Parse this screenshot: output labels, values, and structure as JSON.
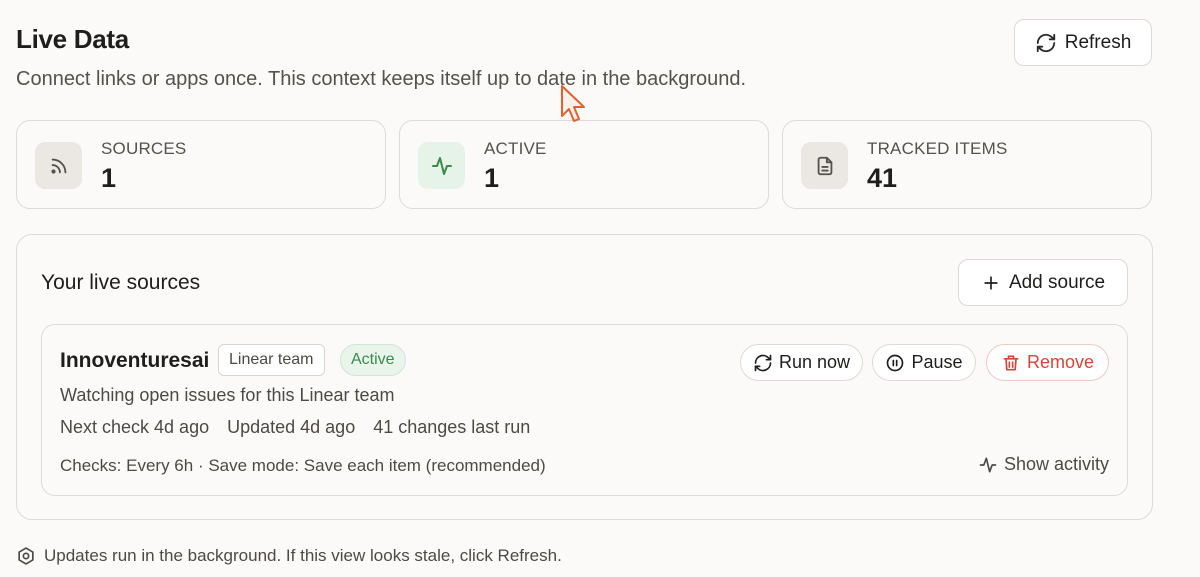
{
  "header": {
    "title": "Live Data",
    "subtitle": "Connect links or apps once. This context keeps itself up to date in the background.",
    "refresh_label": "Refresh",
    "refresh_icon": "refresh-icon"
  },
  "stats": [
    {
      "label": "SOURCES",
      "value": "1",
      "icon": "rss-icon"
    },
    {
      "label": "ACTIVE",
      "value": "1",
      "icon": "activity-icon"
    },
    {
      "label": "TRACKED ITEMS",
      "value": "41",
      "icon": "document-icon"
    }
  ],
  "sources_panel": {
    "title": "Your live sources",
    "add_label": "Add source",
    "sources": [
      {
        "name": "Innoventuresai",
        "type": "Linear team",
        "status": "Active",
        "description": "Watching open issues for this Linear team",
        "next_check": "Next check 4d ago",
        "updated": "Updated 4d ago",
        "changes": "41 changes last run",
        "config": "Checks: Every 6h · Save mode: Save each item (recommended)",
        "actions": {
          "run": "Run now",
          "pause": "Pause",
          "remove": "Remove"
        },
        "activity_label": "Show activity"
      }
    ]
  },
  "footer": {
    "note": "Updates run in the background. If this view looks stale, click Refresh."
  },
  "colors": {
    "background": "#fbfaf8",
    "active_green": "#3a8a4a",
    "danger_red": "#d2463a",
    "border": "#dedbd6"
  }
}
